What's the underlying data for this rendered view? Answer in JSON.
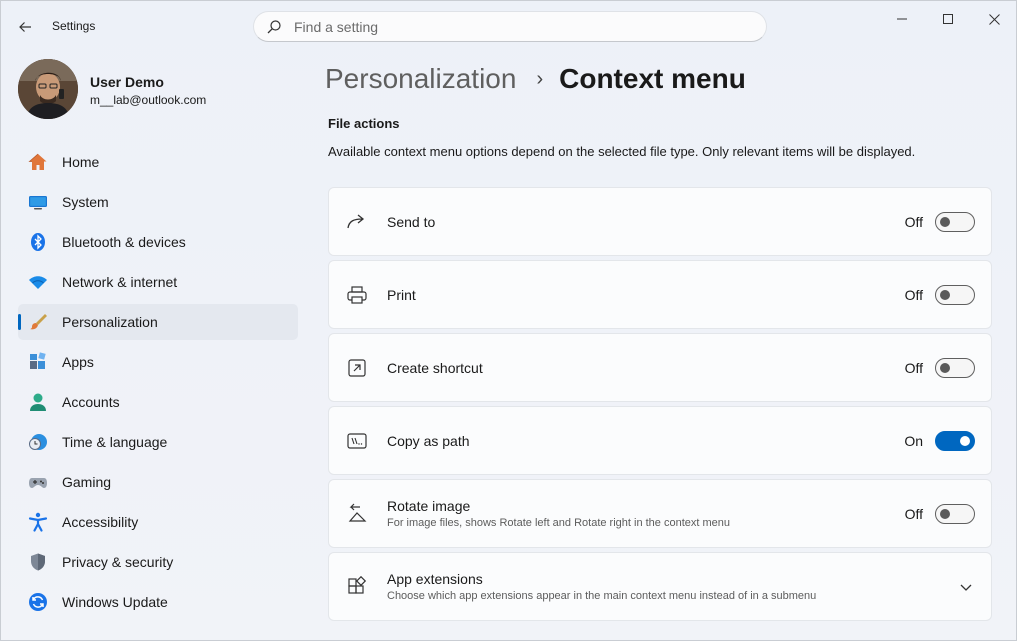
{
  "window": {
    "title": "Settings"
  },
  "search": {
    "placeholder": "Find a setting"
  },
  "user": {
    "name": "User Demo",
    "email": "m__lab@outlook.com"
  },
  "sidebar": {
    "items": [
      {
        "label": "Home",
        "icon": "home-icon"
      },
      {
        "label": "System",
        "icon": "system-icon"
      },
      {
        "label": "Bluetooth & devices",
        "icon": "bluetooth-icon"
      },
      {
        "label": "Network & internet",
        "icon": "wifi-icon"
      },
      {
        "label": "Personalization",
        "icon": "brush-icon",
        "active": true
      },
      {
        "label": "Apps",
        "icon": "apps-icon"
      },
      {
        "label": "Accounts",
        "icon": "accounts-icon"
      },
      {
        "label": "Time & language",
        "icon": "clock-globe-icon"
      },
      {
        "label": "Gaming",
        "icon": "gamepad-icon"
      },
      {
        "label": "Accessibility",
        "icon": "accessibility-icon"
      },
      {
        "label": "Privacy & security",
        "icon": "shield-icon"
      },
      {
        "label": "Windows Update",
        "icon": "update-icon"
      }
    ]
  },
  "header": {
    "parent": "Personalization",
    "separator": "›",
    "current": "Context menu"
  },
  "section": {
    "title": "File actions",
    "description": "Available context menu options depend on the selected file type. Only relevant items will be displayed."
  },
  "settings": [
    {
      "label": "Send to",
      "state": "Off",
      "on": false,
      "icon": "share-arrow-icon"
    },
    {
      "label": "Print",
      "state": "Off",
      "on": false,
      "icon": "printer-icon"
    },
    {
      "label": "Create shortcut",
      "state": "Off",
      "on": false,
      "icon": "shortcut-icon"
    },
    {
      "label": "Copy as path",
      "state": "On",
      "on": true,
      "icon": "path-icon"
    },
    {
      "label": "Rotate image",
      "sub": "For image files, shows Rotate left and Rotate right in the context menu",
      "state": "Off",
      "on": false,
      "icon": "rotate-icon"
    },
    {
      "label": "App extensions",
      "sub": "Choose which app extensions appear in the main context menu instead of in a submenu",
      "icon": "extensions-icon",
      "expandable": true
    }
  ],
  "colors": {
    "accent": "#0067c0",
    "background": "#eef2f7",
    "card": "#fbfcfd"
  }
}
